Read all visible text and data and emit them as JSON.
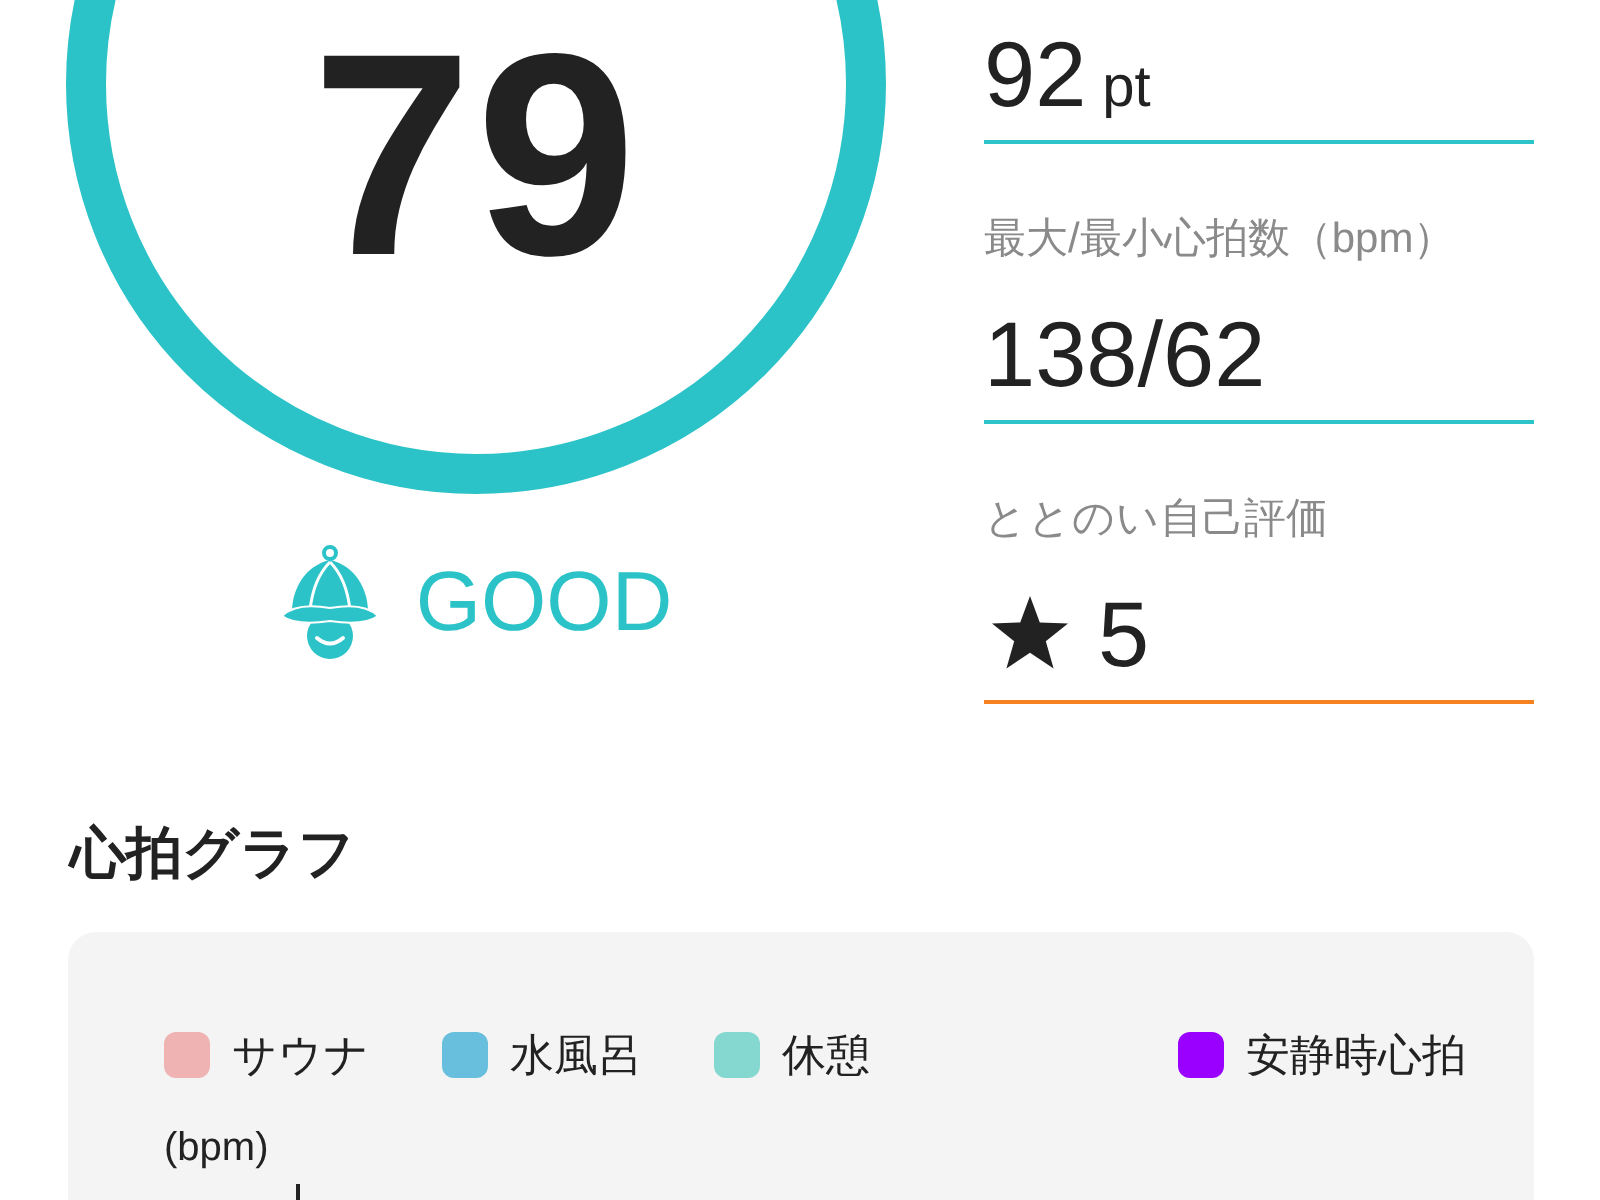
{
  "score": {
    "value": "79",
    "rating_label": "GOOD"
  },
  "stats": [
    {
      "kind": "points",
      "value": "92",
      "unit": "pt",
      "color": "#2cc4c9"
    },
    {
      "kind": "number",
      "label": "最大/最小心拍数（bpm）",
      "value": "138/62",
      "color": "#2cc4c9"
    },
    {
      "kind": "rating",
      "label": "ととのい自己評価",
      "value": "5",
      "color": "#f5821f"
    }
  ],
  "heart_rate_graph": {
    "title": "心拍グラフ",
    "legend": [
      {
        "label": "サウナ",
        "color": "#efb3b3"
      },
      {
        "label": "水風呂",
        "color": "#68bedd"
      },
      {
        "label": "休憩",
        "color": "#85d8cf"
      },
      {
        "label": "安静時心拍",
        "color": "#9a00ff"
      }
    ],
    "y_unit": "(bpm)"
  }
}
